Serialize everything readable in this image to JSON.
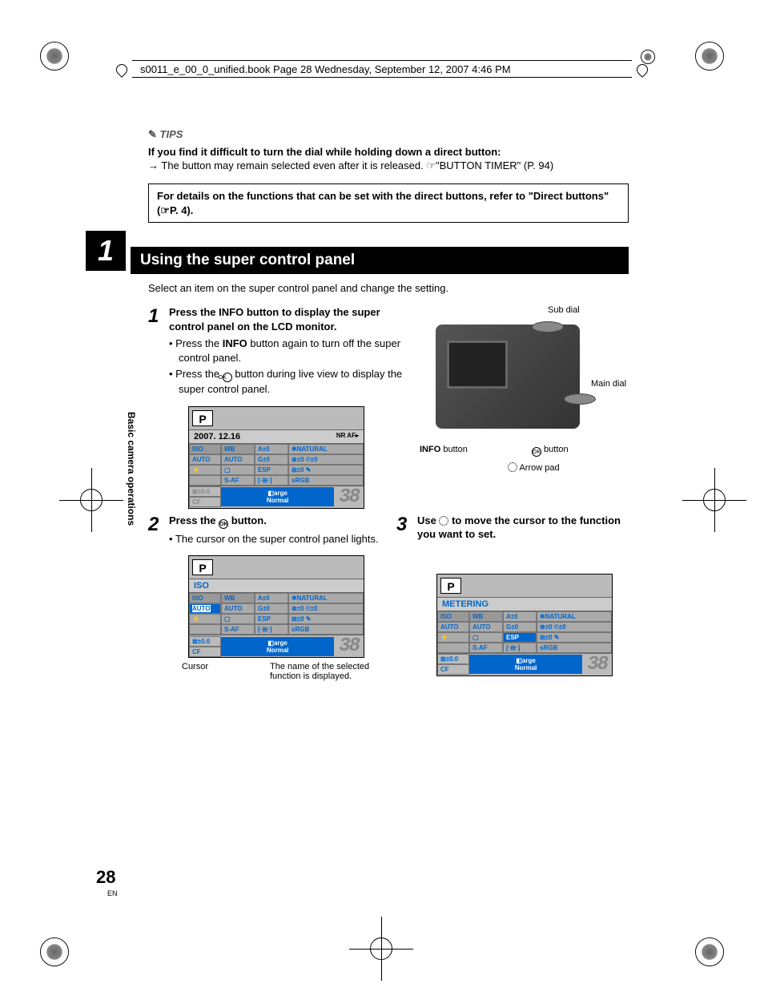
{
  "printMeta": {
    "filename_line": "s0011_e_00_0_unified.book  Page 28  Wednesday, September 12, 2007  4:46 PM"
  },
  "tips": {
    "label": "TIPS",
    "heading": "If you find it difficult to turn the dial while holding down a direct button:",
    "body_prefix": "The button may remain selected even after it is released.  ",
    "body_ref": "☞\"BUTTON TIMER\" (P. 94)"
  },
  "details_box": "For details on the functions that can be set with the direct buttons, refer to \"Direct buttons\" (☞P. 4).",
  "chapter": {
    "number": "1",
    "title": "Using the super control panel"
  },
  "side_label": "Basic camera operations",
  "intro": "Select an item on the super control panel and change the setting.",
  "step1": {
    "num": "1",
    "heading_a": "Press the ",
    "heading_b": "INFO",
    "heading_c": " button to display the super control panel on the LCD monitor.",
    "bullet1_a": "Press the ",
    "bullet1_b": "INFO",
    "bullet1_c": " button again to turn off the super control panel.",
    "bullet2_a": "Press the ",
    "bullet2_b": " button during live view to display the super control panel."
  },
  "diagram": {
    "sub_dial": "Sub dial",
    "main_dial": "Main dial",
    "info_button_a": "INFO",
    "info_button_b": " button",
    "ok_button": " button",
    "arrow_pad": " Arrow pad"
  },
  "lcd1": {
    "mode": "P",
    "date": "2007. 12.16",
    "nr": "NR AF▸",
    "iso": "ISO",
    "wb": "WB",
    "a0": "A±0",
    "natural": "✻NATURAL",
    "auto": "AUTO",
    "g0": "G±0",
    "r0": "⊛±0",
    "c0": "©±0",
    "flash": "⚡",
    "box": "▢",
    "esp": "ESP",
    "w0": "⊞±0",
    "pen": "✎",
    "saf": "S-AF",
    "grid": "[·⊞·]",
    "srgb": "sRGB",
    "exp": "⊠±0.0",
    "large": "◧arge",
    "cf": "CF",
    "normal": "Normal",
    "count": "38"
  },
  "step2": {
    "num": "2",
    "heading_a": "Press the ",
    "heading_b": " button.",
    "bullet1": "The cursor on the super control panel lights."
  },
  "lcd2": {
    "mode": "P",
    "title": "ISO",
    "caption_cursor": "Cursor",
    "caption_name": "The name of the selected function is displayed."
  },
  "step3": {
    "num": "3",
    "heading_a": "Use ",
    "heading_b": " to move the cursor to the function you want to set."
  },
  "lcd3": {
    "mode": "P",
    "title": "METERING"
  },
  "page": {
    "number": "28",
    "lang": "EN"
  }
}
